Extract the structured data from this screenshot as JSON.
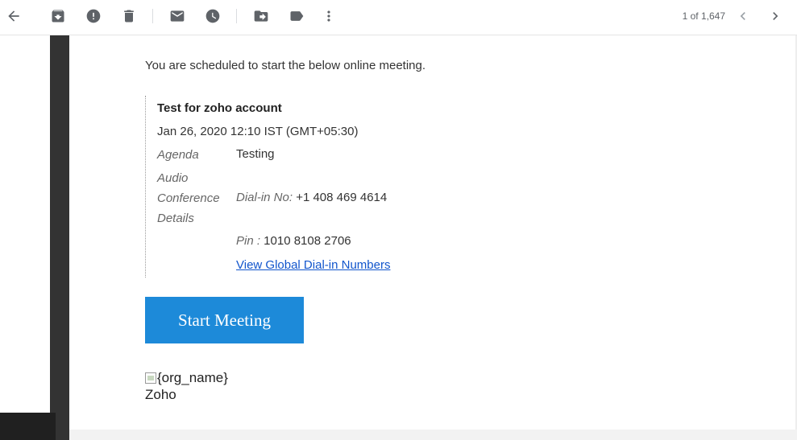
{
  "toolbar": {
    "icons": {
      "back": "arrow-left-icon",
      "archive": "archive-icon",
      "spam": "report-spam-icon",
      "delete": "trash-icon",
      "mark_unread": "mark-unread-icon",
      "snooze": "clock-icon",
      "move": "move-to-icon",
      "label": "label-icon",
      "more": "more-vert-icon",
      "prev": "chevron-left-icon",
      "next": "chevron-right-icon"
    },
    "counter": "1 of 1,647"
  },
  "email": {
    "intro": "You are scheduled to start the below online meeting.",
    "meeting": {
      "title": "Test for zoho account",
      "datetime": "Jan 26, 2020 12:10 IST (GMT+05:30)",
      "agenda_label": "Agenda",
      "agenda_value": "Testing",
      "audio_label_1": "Audio",
      "audio_label_2": "Conference",
      "audio_label_3": "Details",
      "dialin_label": "Dial-in No:",
      "dialin_value": " +1 408 469 4614",
      "pin_label": "Pin :",
      "pin_value": " 1010 8108 2706",
      "global_link": "View Global Dial-in Numbers"
    },
    "start_button": "Start Meeting",
    "logo_alt": "{org_name}",
    "org_name": "Zoho"
  },
  "colors": {
    "accent_button": "#1d8ad9",
    "link": "#1155cc",
    "icon": "#5f6368"
  }
}
